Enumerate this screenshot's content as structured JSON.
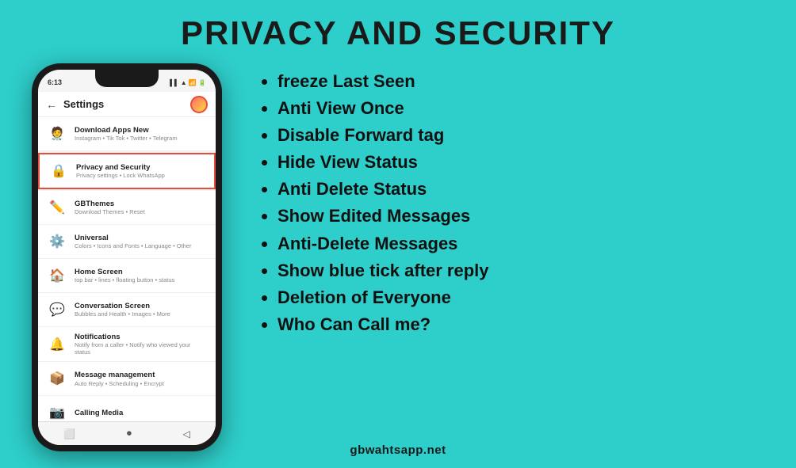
{
  "page": {
    "title": "PRIVACY AND SECURITY",
    "background_color": "#2ececa",
    "footer": "gbwahtsapp.net"
  },
  "phone": {
    "status_time": "6:13",
    "status_dots": "...",
    "header_title": "Settings",
    "menu_items": [
      {
        "id": "download-apps",
        "icon": "🧑‍⚕️",
        "title": "Download Apps New",
        "subtitle": "Instagram • Tik Tok • Twitter • Telegram",
        "highlighted": false
      },
      {
        "id": "privacy-security",
        "icon": "🔒",
        "title": "Privacy and Security",
        "subtitle": "Privacy settings • Lock WhatsApp",
        "highlighted": true
      },
      {
        "id": "gbthemes",
        "icon": "✏️",
        "title": "GBThemes",
        "subtitle": "Download Themes • Reset",
        "highlighted": false
      },
      {
        "id": "universal",
        "icon": "⚙️",
        "title": "Universal",
        "subtitle": "Colors • Icons and Fonts • Language • Other",
        "highlighted": false
      },
      {
        "id": "home-screen",
        "icon": "🏠",
        "title": "Home Screen",
        "subtitle": "top bar • lines • floating button • status",
        "highlighted": false
      },
      {
        "id": "conversation",
        "icon": "💬",
        "title": "Conversation Screen",
        "subtitle": "Bubbles and Health • Images • More",
        "highlighted": false
      },
      {
        "id": "notifications",
        "icon": "🔔",
        "title": "Notifications",
        "subtitle": "Notify from a caller • Notify who viewed your status",
        "highlighted": false
      },
      {
        "id": "message-management",
        "icon": "📦",
        "title": "Message management",
        "subtitle": "Auto Reply • Scheduling • Encrypt",
        "highlighted": false
      },
      {
        "id": "calling-media",
        "icon": "📷",
        "title": "Calling Media",
        "subtitle": "",
        "highlighted": false
      }
    ]
  },
  "features": {
    "items": [
      "freeze Last Seen",
      "Anti View Once",
      "Disable Forward tag",
      "Hide View Status",
      "Anti Delete Status",
      "Show Edited Messages",
      "Anti-Delete Messages",
      "Show blue tick after reply",
      "Deletion of Everyone",
      "Who Can Call me?"
    ]
  }
}
